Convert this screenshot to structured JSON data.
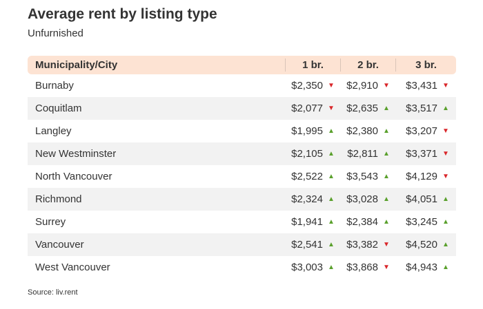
{
  "title": "Average rent by listing type",
  "subtitle": "Unfurnished",
  "columns": [
    "Municipality/City",
    "1 br.",
    "2 br.",
    "3 br."
  ],
  "rows": [
    {
      "city": "Burnaby",
      "v1": "$2,350",
      "d1": "down",
      "v2": "$2,910",
      "d2": "down",
      "v3": "$3,431",
      "d3": "down"
    },
    {
      "city": "Coquitlam",
      "v1": "$2,077",
      "d1": "down",
      "v2": "$2,635",
      "d2": "up",
      "v3": "$3,517",
      "d3": "up"
    },
    {
      "city": "Langley",
      "v1": "$1,995",
      "d1": "up",
      "v2": "$2,380",
      "d2": "up",
      "v3": "$3,207",
      "d3": "down"
    },
    {
      "city": "New Westminster",
      "v1": "$2,105",
      "d1": "up",
      "v2": "$2,811",
      "d2": "up",
      "v3": "$3,371",
      "d3": "down"
    },
    {
      "city": "North Vancouver",
      "v1": "$2,522",
      "d1": "up",
      "v2": "$3,543",
      "d2": "up",
      "v3": "$4,129",
      "d3": "down"
    },
    {
      "city": "Richmond",
      "v1": "$2,324",
      "d1": "up",
      "v2": "$3,028",
      "d2": "up",
      "v3": "$4,051",
      "d3": "up"
    },
    {
      "city": "Surrey",
      "v1": "$1,941",
      "d1": "up",
      "v2": "$2,384",
      "d2": "up",
      "v3": "$3,245",
      "d3": "up"
    },
    {
      "city": "Vancouver",
      "v1": "$2,541",
      "d1": "up",
      "v2": "$3,382",
      "d2": "down",
      "v3": "$4,520",
      "d3": "up"
    },
    {
      "city": "West Vancouver",
      "v1": "$3,003",
      "d1": "up",
      "v2": "$3,868",
      "d2": "down",
      "v3": "$4,943",
      "d3": "up"
    }
  ],
  "source": "Source: liv.rent",
  "colors": {
    "up": "#5aa02c",
    "down": "#d9262a",
    "header_bg": "#fde3d3",
    "row_alt": "#f2f2f2"
  },
  "icons": {
    "up": "triangle-up-icon",
    "down": "triangle-down-icon"
  }
}
